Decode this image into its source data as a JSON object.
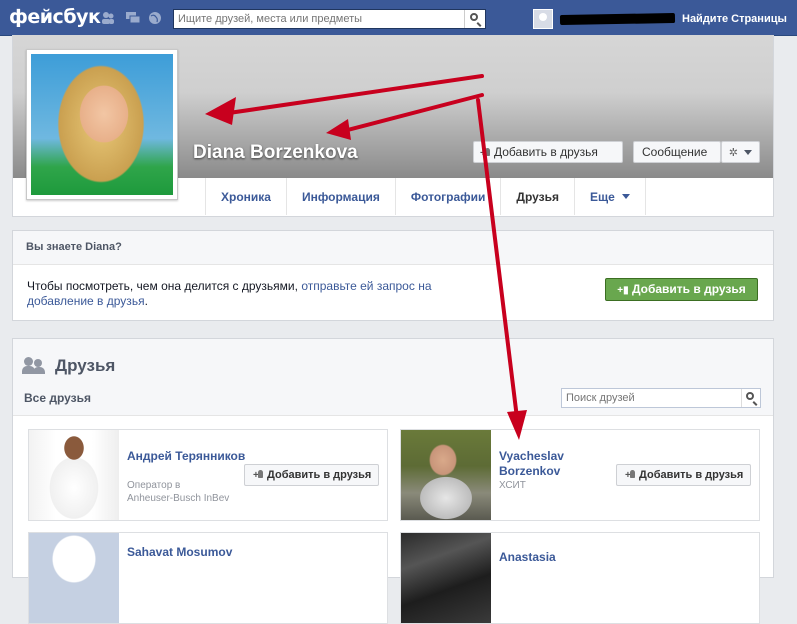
{
  "topbar": {
    "logo": "фейсбук",
    "search_placeholder": "Ищите друзей, места или предметы",
    "link_find": "Найдите Страницы"
  },
  "profile": {
    "name": "Diana Borzenkova",
    "add_friend_label": "Добавить в друзья",
    "message_label": "Сообщение",
    "tabs": [
      {
        "label": "Хроника"
      },
      {
        "label": "Информация"
      },
      {
        "label": "Фотографии"
      },
      {
        "label": "Друзья"
      },
      {
        "label": "Еще"
      }
    ]
  },
  "know": {
    "title": "Вы знаете Diana?",
    "text_plain": "Чтобы посмотреть, чем она делится с друзьями, ",
    "text_link": "отправьте ей запрос на добавление в друзья",
    "text_end": ".",
    "button_label": "Добавить в друзья"
  },
  "friends": {
    "title": "Друзья",
    "all_label": "Все друзья",
    "search_placeholder": "Поиск друзей",
    "cards": [
      {
        "name": "Андрей Терянников",
        "sub1": "Оператор в",
        "sub2": "Anheuser-Busch InBev",
        "add_label": "Добавить в друзья"
      },
      {
        "name": "Vyacheslav Borzenkov",
        "sub1": "ХСИТ",
        "sub2": "",
        "add_label": "Добавить в друзья"
      },
      {
        "name": "Sahavat Mosumov"
      },
      {
        "name": "Anastasia"
      }
    ]
  },
  "colors": {
    "brand": "#3b5998",
    "green_button": "#69a74e",
    "annotation_arrow": "#c8001e"
  }
}
